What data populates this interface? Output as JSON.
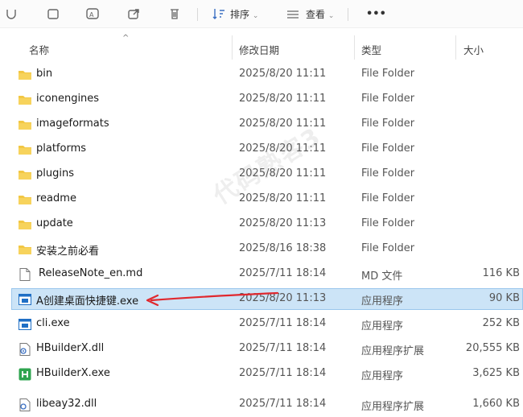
{
  "toolbar": {
    "sort_label": "排序",
    "view_label": "查看",
    "more_label": "•••"
  },
  "columns": {
    "name": "名称",
    "date": "修改日期",
    "type": "类型",
    "size": "大小"
  },
  "watermark_text": "代码熟客3",
  "files": [
    {
      "name": "bin",
      "date": "2025/8/20 11:11",
      "type": "File Folder",
      "size": "",
      "icon": "folder-icon"
    },
    {
      "name": "iconengines",
      "date": "2025/8/20 11:11",
      "type": "File Folder",
      "size": "",
      "icon": "folder-icon"
    },
    {
      "name": "imageformats",
      "date": "2025/8/20 11:11",
      "type": "File Folder",
      "size": "",
      "icon": "folder-icon"
    },
    {
      "name": "platforms",
      "date": "2025/8/20 11:11",
      "type": "File Folder",
      "size": "",
      "icon": "folder-icon"
    },
    {
      "name": "plugins",
      "date": "2025/8/20 11:11",
      "type": "File Folder",
      "size": "",
      "icon": "folder-icon"
    },
    {
      "name": "readme",
      "date": "2025/8/20 11:11",
      "type": "File Folder",
      "size": "",
      "icon": "folder-icon"
    },
    {
      "name": "update",
      "date": "2025/8/20 11:13",
      "type": "File Folder",
      "size": "",
      "icon": "folder-icon"
    },
    {
      "name": "安装之前必看",
      "date": "2025/8/16 18:38",
      "type": "File Folder",
      "size": "",
      "icon": "folder-icon"
    },
    {
      "name": "ReleaseNote_en.md",
      "date": "2025/7/11 18:14",
      "type": "MD 文件",
      "size": "116 KB",
      "icon": "document-icon"
    },
    {
      "name": "A创建桌面快捷键.exe",
      "date": "2025/8/20 11:13",
      "type": "应用程序",
      "size": "90 KB",
      "icon": "app-window-icon",
      "selected": true
    },
    {
      "name": "cli.exe",
      "date": "2025/7/11 18:14",
      "type": "应用程序",
      "size": "252 KB",
      "icon": "app-window-icon"
    },
    {
      "name": "HBuilderX.dll",
      "date": "2025/7/11 18:14",
      "type": "应用程序扩展",
      "size": "20,555 KB",
      "icon": "dll-gear-icon"
    },
    {
      "name": "HBuilderX.exe",
      "date": "2025/7/11 18:14",
      "type": "应用程序",
      "size": "3,625 KB",
      "icon": "hbuilder-icon"
    }
  ],
  "partial_row": {
    "name": "libeay32.dll",
    "date": "2025/7/11 18:14",
    "type": "应用程序扩展",
    "size": "1,660 KB"
  },
  "colors": {
    "folder": "#f2c744",
    "selected_bg": "#cce4f7",
    "selected_border": "#9ac6ec",
    "arrow": "#e0282e",
    "app_icon": "#1f6fc5",
    "hbuilder": "#2ea44f"
  }
}
